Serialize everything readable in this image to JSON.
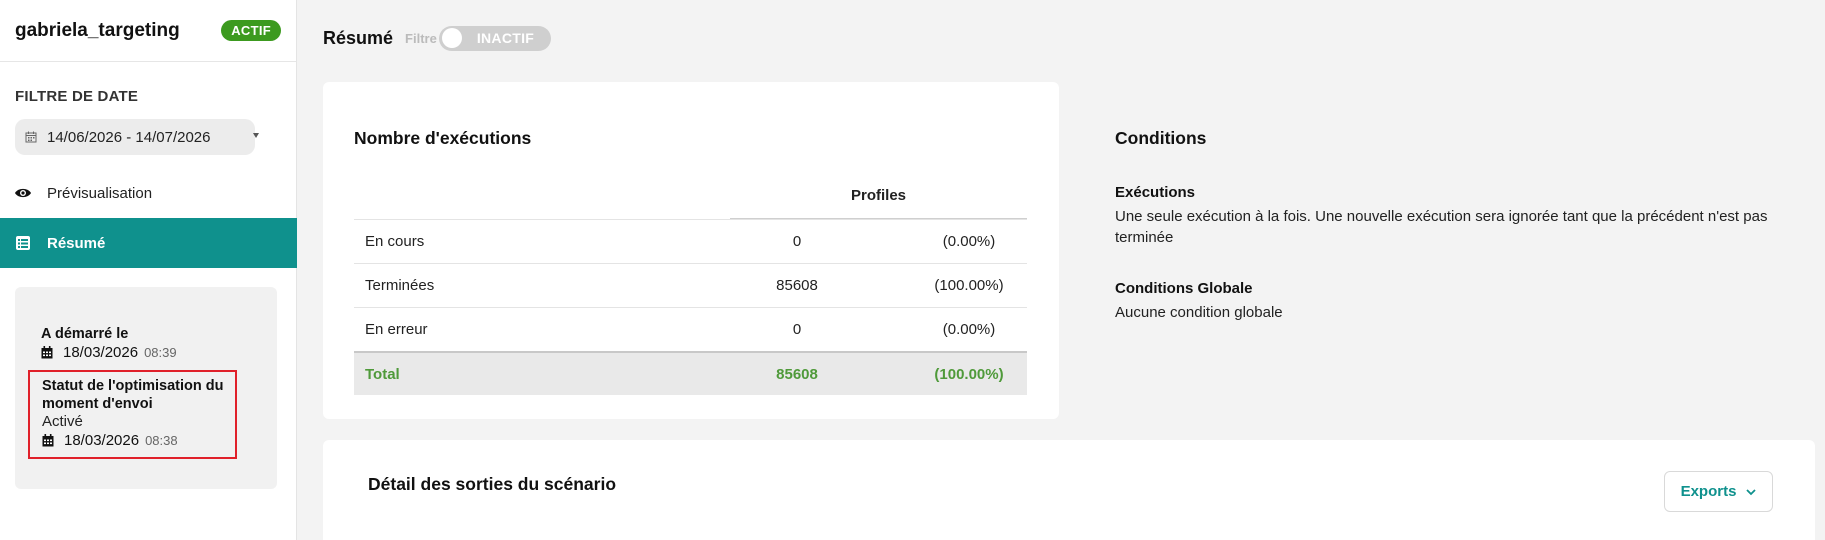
{
  "sidebar": {
    "campaign_name": "gabriela_targeting",
    "status_badge": "ACTIF",
    "date_filter_label": "FILTRE DE DATE",
    "date_range": "14/06/2026 - 14/07/2026",
    "nav": {
      "preview": "Prévisualisation",
      "summary": "Résumé"
    },
    "started": {
      "label": "A démarré le",
      "date": "18/03/2026",
      "time": "08:39"
    },
    "send_time_optimization": {
      "label": "Statut de l'optimisation du moment d'envoi",
      "status": "Activé",
      "date": "18/03/2026",
      "time": "08:38"
    }
  },
  "topbar": {
    "title": "Résumé",
    "filter_label": "Filtre",
    "toggle_label": "INACTIF"
  },
  "executions": {
    "title": "Nombre d'exécutions",
    "column_header": "Profiles",
    "rows": [
      {
        "label": "En cours",
        "count": "0",
        "percent": "(0.00%)"
      },
      {
        "label": "Terminées",
        "count": "85608",
        "percent": "(100.00%)"
      },
      {
        "label": "En erreur",
        "count": "0",
        "percent": "(0.00%)"
      }
    ],
    "total": {
      "label": "Total",
      "count": "85608",
      "percent": "(100.00%)"
    }
  },
  "conditions": {
    "title": "Conditions",
    "executions_label": "Exécutions",
    "executions_text": "Une seule exécution à la fois. Une nouvelle exécution sera ignorée tant que la précédent n'est pas terminée",
    "global_label": "Conditions Globale",
    "global_text": "Aucune condition globale"
  },
  "detail": {
    "title": "Détail des sorties du scénario",
    "exports_label": "Exports"
  },
  "colors": {
    "accent": "#0f918d",
    "active_badge": "#3c9a1f",
    "total_text": "#4f9a3a",
    "highlight_border": "#e0202a"
  }
}
